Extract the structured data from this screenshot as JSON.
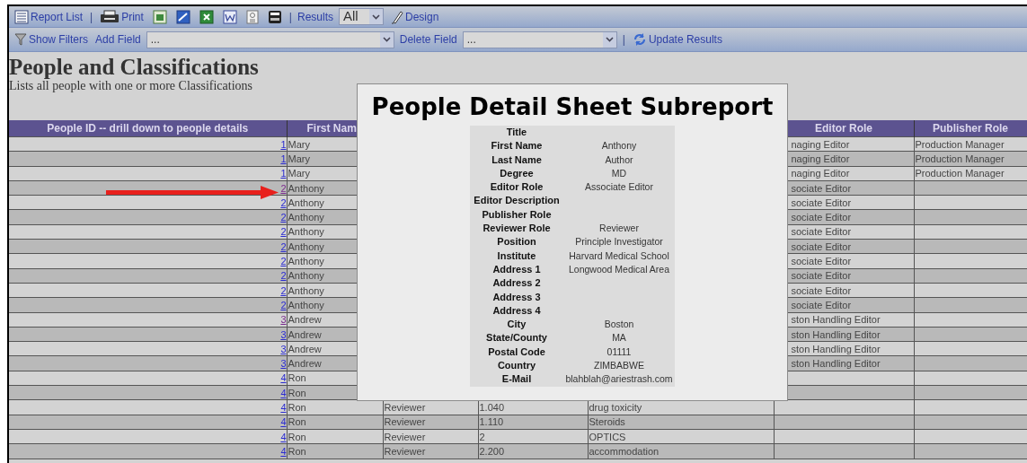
{
  "toolbar_1": [
    {
      "kind": "icon-button",
      "label": "Report List"
    },
    {
      "kind": "separator",
      "text": "|"
    },
    {
      "kind": "icon-button",
      "label": "Print"
    },
    {
      "kind": "icon-button"
    },
    {
      "kind": "icon-button"
    },
    {
      "kind": "icon-button"
    },
    {
      "kind": "icon-button"
    },
    {
      "kind": "icon-button"
    },
    {
      "kind": "icon-button"
    },
    {
      "kind": "separator",
      "text": "|"
    },
    {
      "kind": "label",
      "text": "Results"
    },
    {
      "kind": "select",
      "value": "All"
    },
    {
      "kind": "icon-button",
      "label": "Design"
    }
  ],
  "toolbar_2": [
    {
      "kind": "icon-button",
      "label": "Show Filters"
    },
    {
      "kind": "label",
      "text": "Add Field"
    },
    {
      "kind": "select",
      "value": "..."
    },
    {
      "kind": "label",
      "text": "Delete Field"
    },
    {
      "kind": "select",
      "value": "..."
    },
    {
      "kind": "separator",
      "text": "|"
    },
    {
      "kind": "icon-button",
      "label": "Update Results"
    }
  ],
  "report": {
    "title": "People and Classifications",
    "subtitle": "Lists all people with one or more Classifications"
  },
  "table": {
    "header": {
      "people_id": "People ID -- drill down to people details",
      "first_name": "First Nam",
      "editor_role": "Editor Role",
      "publisher_role": "Publisher Role"
    },
    "rows": [
      {
        "id": "1",
        "visited": false,
        "first_name": "Mary",
        "editor_role": "naging Editor",
        "publisher_role": "Production Manager"
      },
      {
        "id": "1",
        "visited": false,
        "first_name": "Mary",
        "editor_role": "naging Editor",
        "publisher_role": "Production Manager"
      },
      {
        "id": "1",
        "visited": false,
        "first_name": "Mary",
        "editor_role": "naging Editor",
        "publisher_role": "Production Manager"
      },
      {
        "id": "2",
        "visited": true,
        "first_name": "Anthony",
        "editor_role": "sociate Editor"
      },
      {
        "id": "2",
        "visited": false,
        "first_name": "Anthony",
        "editor_role": "sociate Editor"
      },
      {
        "id": "2",
        "visited": false,
        "first_name": "Anthony",
        "editor_role": "sociate Editor"
      },
      {
        "id": "2",
        "visited": false,
        "first_name": "Anthony",
        "editor_role": "sociate Editor"
      },
      {
        "id": "2",
        "visited": false,
        "first_name": "Anthony",
        "editor_role": "sociate Editor"
      },
      {
        "id": "2",
        "visited": false,
        "first_name": "Anthony",
        "editor_role": "sociate Editor"
      },
      {
        "id": "2",
        "visited": false,
        "first_name": "Anthony",
        "editor_role": "sociate Editor"
      },
      {
        "id": "2",
        "visited": false,
        "first_name": "Anthony",
        "editor_role": "sociate Editor"
      },
      {
        "id": "2",
        "visited": false,
        "first_name": "Anthony",
        "editor_role": "sociate Editor"
      },
      {
        "id": "3",
        "visited": true,
        "first_name": "Andrew",
        "editor_role": "ston Handling Editor"
      },
      {
        "id": "3",
        "visited": false,
        "first_name": "Andrew",
        "editor_role": "ston Handling Editor"
      },
      {
        "id": "3",
        "visited": false,
        "first_name": "Andrew",
        "editor_role": "ston Handling Editor"
      },
      {
        "id": "3",
        "visited": false,
        "first_name": "Andrew",
        "editor_role": "ston Handling Editor"
      },
      {
        "id": "4",
        "visited": false,
        "first_name": "Ron"
      },
      {
        "id": "4",
        "visited": false,
        "first_name": "Ron"
      },
      {
        "id": "4",
        "visited": false,
        "first_name": "Ron",
        "column_3": "Reviewer",
        "column_4": "1.040",
        "column_5": "drug toxicity"
      },
      {
        "id": "4",
        "visited": false,
        "first_name": "Ron",
        "column_3": "Reviewer",
        "column_4": "1.110",
        "column_5": "Steroids"
      },
      {
        "id": "4",
        "visited": false,
        "first_name": "Ron",
        "column_3": "Reviewer",
        "column_4": "2",
        "column_5": "OPTICS"
      },
      {
        "id": "4",
        "visited": false,
        "first_name": "Ron",
        "column_3": "Reviewer",
        "column_4": "2.200",
        "column_5": "accommodation"
      }
    ]
  },
  "popup": {
    "title": "People Detail Sheet Subreport",
    "fields": [
      {
        "label": "Title"
      },
      {
        "label": "First Name",
        "value": "Anthony"
      },
      {
        "label": "Last Name",
        "value": "Author"
      },
      {
        "label": "Degree",
        "value": "MD"
      },
      {
        "label": "Editor Role",
        "value": "Associate Editor"
      },
      {
        "label": "Editor Description"
      },
      {
        "label": "Publisher Role"
      },
      {
        "label": "Reviewer Role",
        "value": "Reviewer"
      },
      {
        "label": "Position",
        "value": "Principle Investigator"
      },
      {
        "label": "Institute",
        "value": "Harvard Medical School"
      },
      {
        "label": "Address 1",
        "value": "Longwood Medical Area"
      },
      {
        "label": "Address 2"
      },
      {
        "label": "Address 3"
      },
      {
        "label": "Address 4"
      },
      {
        "label": "City",
        "value": "Boston"
      },
      {
        "label": "State/County",
        "value": "MA"
      },
      {
        "label": "Postal Code",
        "value": "01111"
      },
      {
        "label": "Country",
        "value": "ZIMBABWE"
      },
      {
        "label": "E-Mail",
        "value": "blahblah@ariestrash.com"
      }
    ]
  }
}
